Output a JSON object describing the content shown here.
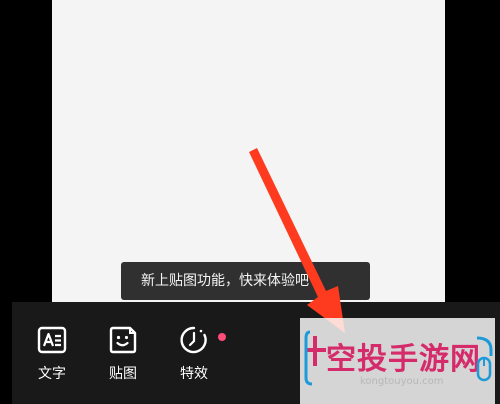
{
  "tooltip": {
    "text": "新上贴图功能，快来体验吧"
  },
  "toolbar": {
    "items": [
      {
        "label": "文字",
        "icon": "text-icon"
      },
      {
        "label": "贴图",
        "icon": "sticker-icon"
      },
      {
        "label": "特效",
        "icon": "effect-icon"
      }
    ]
  },
  "watermark": {
    "text": "空投手游网",
    "sub": "kongtouyou.com"
  },
  "colors": {
    "background": "#000000",
    "canvas": "#f4f4f4",
    "toolbar": "#191919",
    "tooltip": "#303030",
    "arrow": "#ff3b1f",
    "badge_dot": "#ff4d7a",
    "watermark": "#d62b6a"
  }
}
